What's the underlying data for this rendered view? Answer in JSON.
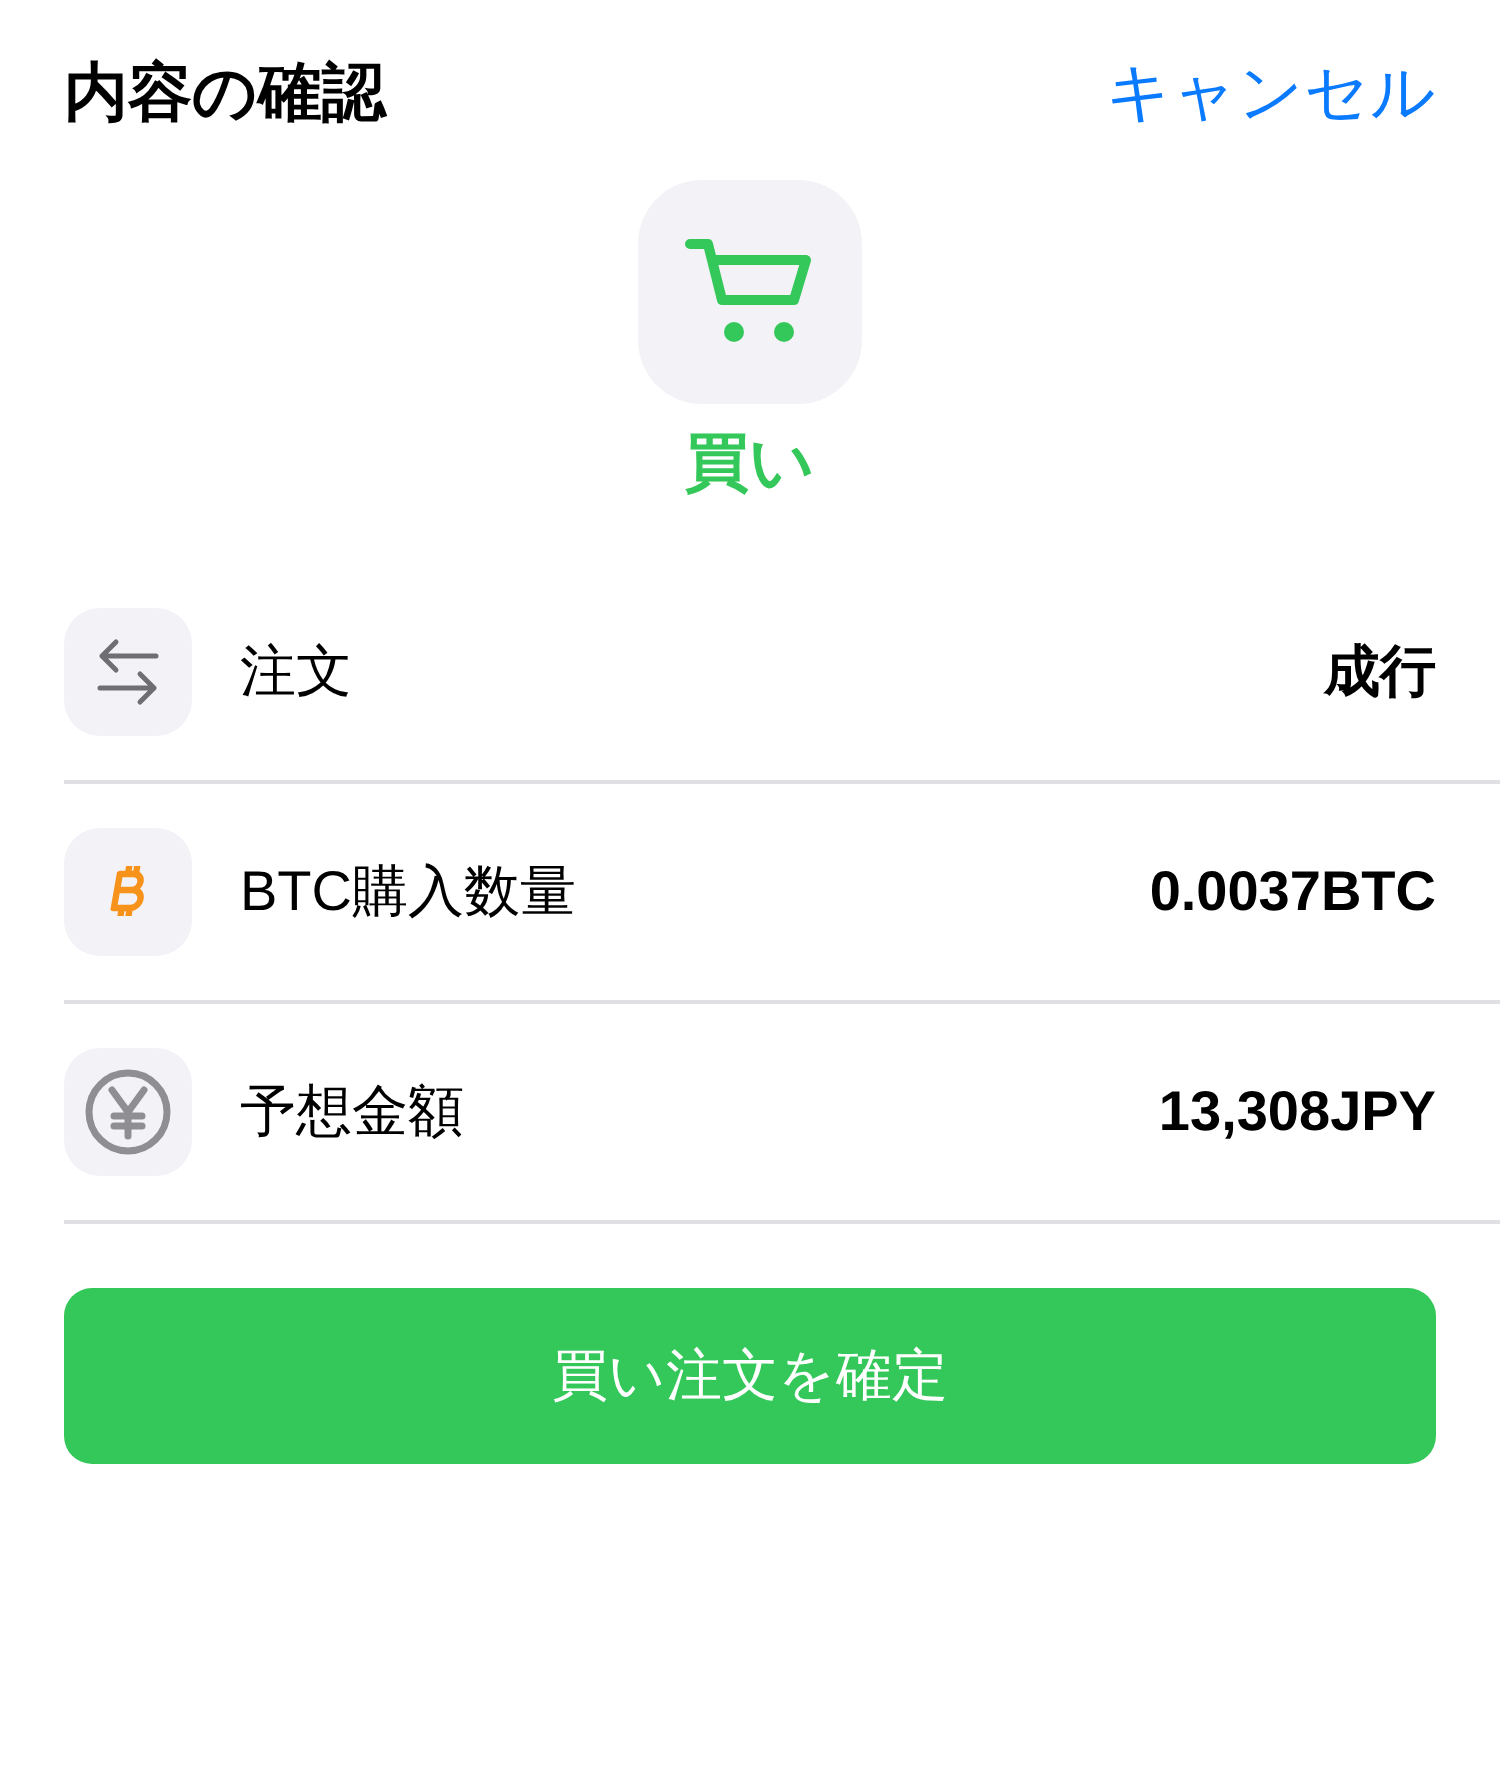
{
  "header": {
    "title": "内容の確認",
    "cancel": "キャンセル"
  },
  "order_type": {
    "label": "買い"
  },
  "rows": [
    {
      "kind": "swap",
      "label": "注文",
      "value": "成行"
    },
    {
      "kind": "bitcoin",
      "label": "BTC購入数量",
      "value": "0.0037BTC"
    },
    {
      "kind": "yen",
      "label": "予想金額",
      "value": "13,308JPY"
    }
  ],
  "confirm_button": "買い注文を確定"
}
